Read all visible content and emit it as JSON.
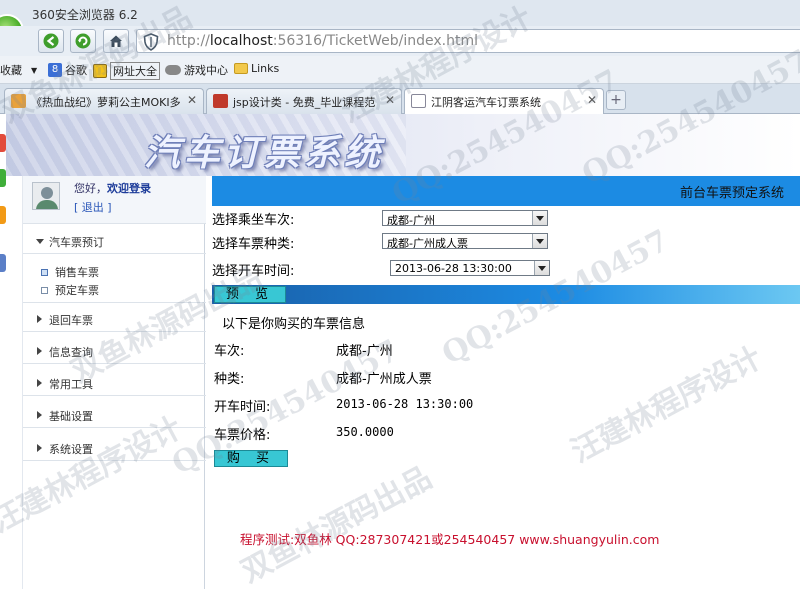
{
  "browser": {
    "title": "360安全浏览器 6.2",
    "address_host": "localhost",
    "address_prefix": "http://",
    "address_suffix": ":56316/TicketWeb/index.html",
    "favorites_label": "收藏",
    "favorites": [
      "谷歌",
      "网址大全",
      "游戏中心",
      "Links"
    ],
    "tabs": [
      {
        "label": "《热血战纪》萝莉公主MOKI多",
        "active": false
      },
      {
        "label": "jsp设计类 - 免费_毕业课程范",
        "active": false
      },
      {
        "label": "江阴客运汽车订票系统",
        "active": true
      }
    ],
    "colors": {
      "logo": "#4fb02e",
      "nav_bg": "#e8eef5"
    }
  },
  "page": {
    "system_title": "汽车订票系统",
    "user": {
      "greeting": "您好，",
      "login_link": "欢迎登录",
      "logout": "[ 退出 ]"
    },
    "menu": {
      "group_expanded": "汽车票预订",
      "subitems": [
        {
          "label": "销售车票",
          "selected": true
        },
        {
          "label": "预定车票",
          "selected": false
        }
      ],
      "groups": [
        "退回车票",
        "信息查询",
        "常用工具",
        "基础设置",
        "系统设置"
      ]
    },
    "main": {
      "header": "前台车票预定系统",
      "form": {
        "route_label": "选择乘坐车次:",
        "route_value": "成都-广州",
        "type_label": "选择车票种类:",
        "type_value": "成都-广州成人票",
        "time_label": "选择开车时间:",
        "time_value": "2013-06-28 13:30:00"
      },
      "preview_button": "预 览",
      "info_title": "以下是你购买的车票信息",
      "info": {
        "route_label": "车次:",
        "route_value": "成都-广州",
        "type_label": "种类:",
        "type_value": "成都-广州成人票",
        "time_label": "开车时间:",
        "time_value": "2013-06-28 13:30:00",
        "price_label": "车票价格:",
        "price_value": "350.0000"
      },
      "buy_button": "购 买",
      "footer": "程序测试:双鱼林 QQ:287307421或254540457 www.shuangyulin.com"
    },
    "colors": {
      "header_blue": "#1c8be3",
      "button_cyan": "#38c7d4",
      "footer_red": "#c8102e"
    }
  },
  "watermarks": [
    "双鱼林源码出品",
    "汪建林程序设计",
    "QQ:254540457",
    "双鱼林源码出品",
    "汪建林程序设计",
    "QQ:254540457",
    "双鱼林源码出品",
    "QQ:254540457",
    "汪建林程序设计",
    "QQ:254540457"
  ]
}
